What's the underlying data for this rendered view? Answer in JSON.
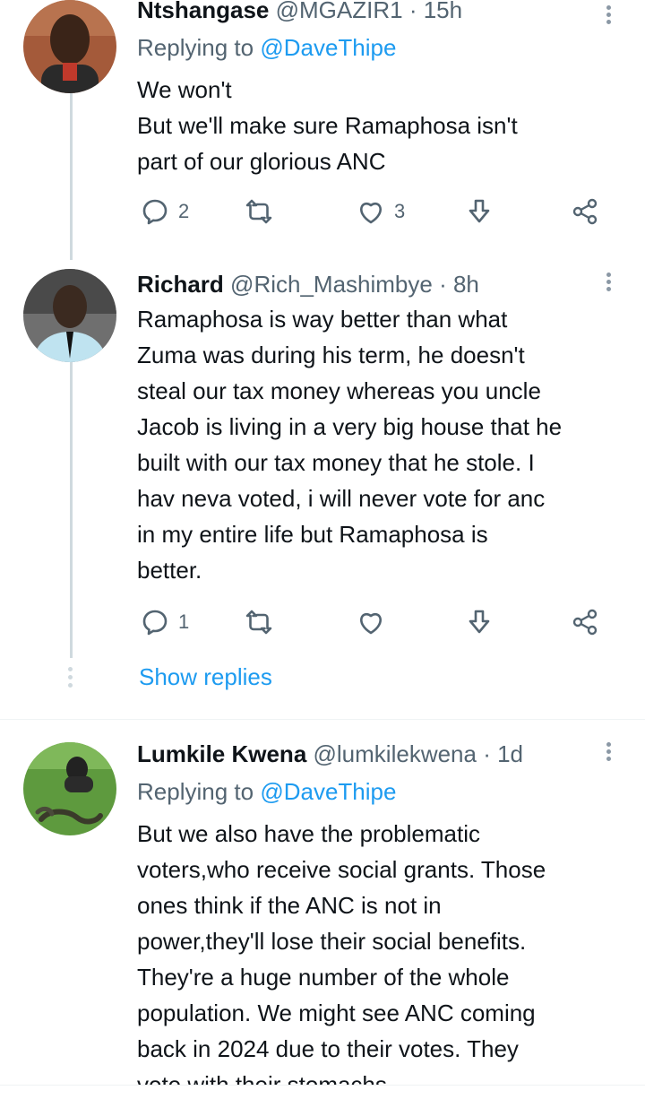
{
  "tweets": [
    {
      "name": "Ntshangase",
      "handle": "@MGAZIR1",
      "time": "· 15h",
      "replying_label": "Replying to",
      "replying_to": "@DaveThipe",
      "lines": [
        "We won't",
        "But we'll make sure Ramaphosa isn't",
        "part of our glorious ANC"
      ],
      "actions": {
        "reply_count": "2",
        "retweet_count": "",
        "like_count": "3"
      }
    },
    {
      "name": "Richard",
      "handle": "@Rich_Mashimbye",
      "time": "· 8h",
      "lines": [
        "Ramaphosa is way better than what",
        "Zuma was during his term, he doesn't",
        "steal our tax money whereas you uncle",
        "Jacob is living in a very big house that he",
        "built with our tax money that he stole. I",
        "hav neva voted, i will never vote for anc",
        "in my entire life but Ramaphosa is",
        "better."
      ],
      "actions": {
        "reply_count": "1",
        "retweet_count": "",
        "like_count": ""
      }
    },
    {
      "name": "Lumkile Kwena",
      "handle": "@lumkilekwena",
      "time": "· 1d",
      "replying_label": "Replying to",
      "replying_to": "@DaveThipe",
      "lines": [
        "But we also have the problematic",
        "voters,who receive social grants. Those",
        "ones think if the ANC is not in",
        "power,they'll lose their social benefits.",
        "They're a huge number of the whole",
        "population. We might see ANC coming",
        "back in 2024 due to their votes. They",
        "vote with their stomachs"
      ]
    }
  ],
  "show_replies": "Show replies",
  "icons": [
    "reply-icon",
    "retweet-icon",
    "like-icon",
    "bookmark-icon",
    "share-icon",
    "more-icon"
  ],
  "colors": {
    "link": "#1d9bf0",
    "secondary": "#536471",
    "text": "#0f1419"
  }
}
